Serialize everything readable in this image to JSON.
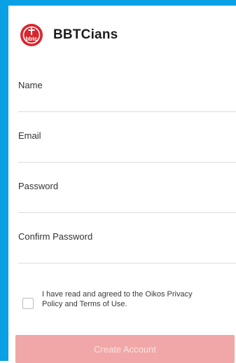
{
  "app": {
    "title": "BBTCians",
    "logo_icon": "bbtc-logo-icon",
    "logo_text": "bbtc"
  },
  "form": {
    "fields": [
      {
        "label": "Name",
        "value": "",
        "placeholder": ""
      },
      {
        "label": "Email",
        "value": "",
        "placeholder": ""
      },
      {
        "label": "Password",
        "value": "",
        "placeholder": ""
      },
      {
        "label": "Confirm Password",
        "value": "",
        "placeholder": ""
      }
    ],
    "agreement": {
      "checked": false,
      "text": "I have read and agreed to the Oikos Privacy Policy and Terms of Use."
    },
    "submit_label": "Create Account"
  },
  "colors": {
    "frame": "#0aa0e6",
    "logo_red": "#d8262e",
    "button_disabled_bg": "#f1a7a7",
    "button_disabled_text": "#fbe3e3"
  }
}
